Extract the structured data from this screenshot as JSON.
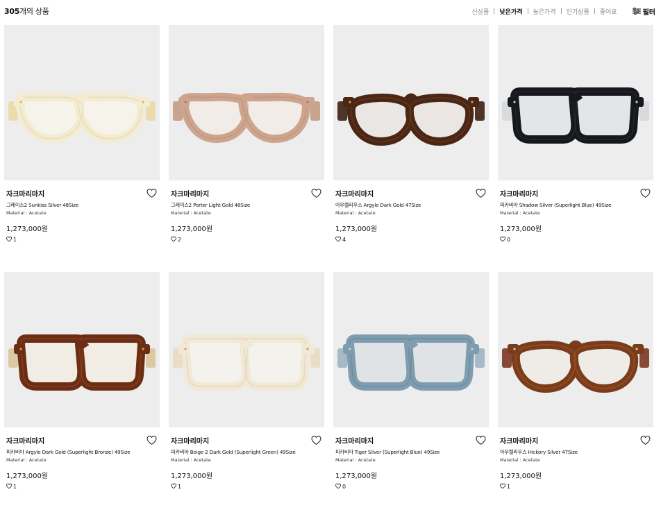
{
  "header": {
    "count_num": "305",
    "count_rest": "개의 상품",
    "sort_options": [
      "신상품",
      "낮은가격",
      "높은가격",
      "인기상품",
      "좋아요"
    ],
    "active_sort": "낮은가격",
    "filter_label": "필터",
    "filter_icon": "sliders-icon"
  },
  "products": [
    {
      "brand": "자크마리마지",
      "name": "그레이스2 Sunkiss Silver 48Size",
      "material": "Material : Acetate",
      "price": "1,273,000원",
      "likes": "1",
      "glasses": {
        "style": "cateye",
        "frame": "#f3ecd2",
        "rim": "#e6d9ad",
        "accent": "#d9b654",
        "lens": "#f6f4ea",
        "temple": "#ead9a6"
      }
    },
    {
      "brand": "자크마리마지",
      "name": "그레이스2 Porter Light Gold 48Size",
      "material": "Material : Acetate",
      "price": "1,273,000원",
      "likes": "2",
      "glasses": {
        "style": "cateye",
        "frame": "#cda58e",
        "rim": "#bd927a",
        "accent": "#a87c64",
        "lens": "#f2ece8",
        "temple": "#c49a82"
      }
    },
    {
      "brand": "자크마리마지",
      "name": "아우렐리우스 Argyle Dark Gold 47Size",
      "material": "Material : Acetate",
      "price": "1,273,000원",
      "likes": "4",
      "glasses": {
        "style": "round",
        "frame": "#4a2614",
        "rim": "#6b3a1c",
        "accent": "#c9a45a",
        "lens": "#e9e6e3",
        "temple": "#3c2012"
      }
    },
    {
      "brand": "자크마리마지",
      "name": "피카비아 Shadow Silver (Superlight Blue) 49Size",
      "material": "Material : Acetate",
      "price": "1,273,000원",
      "likes": "0",
      "glasses": {
        "style": "square",
        "frame": "#16181b",
        "rim": "#2a2d31",
        "accent": "#c8c8c8",
        "lens": "#e3e6e8",
        "temple": "#d4d8da"
      }
    },
    {
      "brand": "자크마리마지",
      "name": "피카비아 Argyle Dark Gold (Superlight Bronze) 49Size",
      "material": "Material : Acetate",
      "price": "1,273,000원",
      "likes": "1",
      "glasses": {
        "style": "square",
        "frame": "#6b2e14",
        "rim": "#8b4220",
        "accent": "#c9a45a",
        "lens": "#f1ece4",
        "temple": "#d9c49a"
      }
    },
    {
      "brand": "자크마리마지",
      "name": "피카비아 Beige 2 Dark Gold (Superlight Green) 49Size",
      "material": "Material : Acetate",
      "price": "1,273,000원",
      "likes": "1",
      "glasses": {
        "style": "square",
        "frame": "#f1e8d6",
        "rim": "#e3d5b8",
        "accent": "#c6a65c",
        "lens": "#f4f2ec",
        "temple": "#e8dcc0"
      }
    },
    {
      "brand": "자크마리마지",
      "name": "피카비아 Tiger Silver (Superlight Blue) 49Size",
      "material": "Material : Acetate",
      "price": "1,273,000원",
      "likes": "0",
      "glasses": {
        "style": "square",
        "frame": "#7f9db0",
        "rim": "#6a879a",
        "accent": "#d0d0d0",
        "lens": "#dfe3e6",
        "temple": "#9db3c2"
      }
    },
    {
      "brand": "자크마리마지",
      "name": "아우렐리우스 Hickory Silver 47Size",
      "material": "Material : Acetate",
      "price": "1,273,000원",
      "likes": "1",
      "glasses": {
        "style": "round",
        "frame": "#7a3c1a",
        "rim": "#9c5428",
        "accent": "#cfcfcf",
        "lens": "#efebe7",
        "temple": "#7b3522"
      }
    }
  ]
}
